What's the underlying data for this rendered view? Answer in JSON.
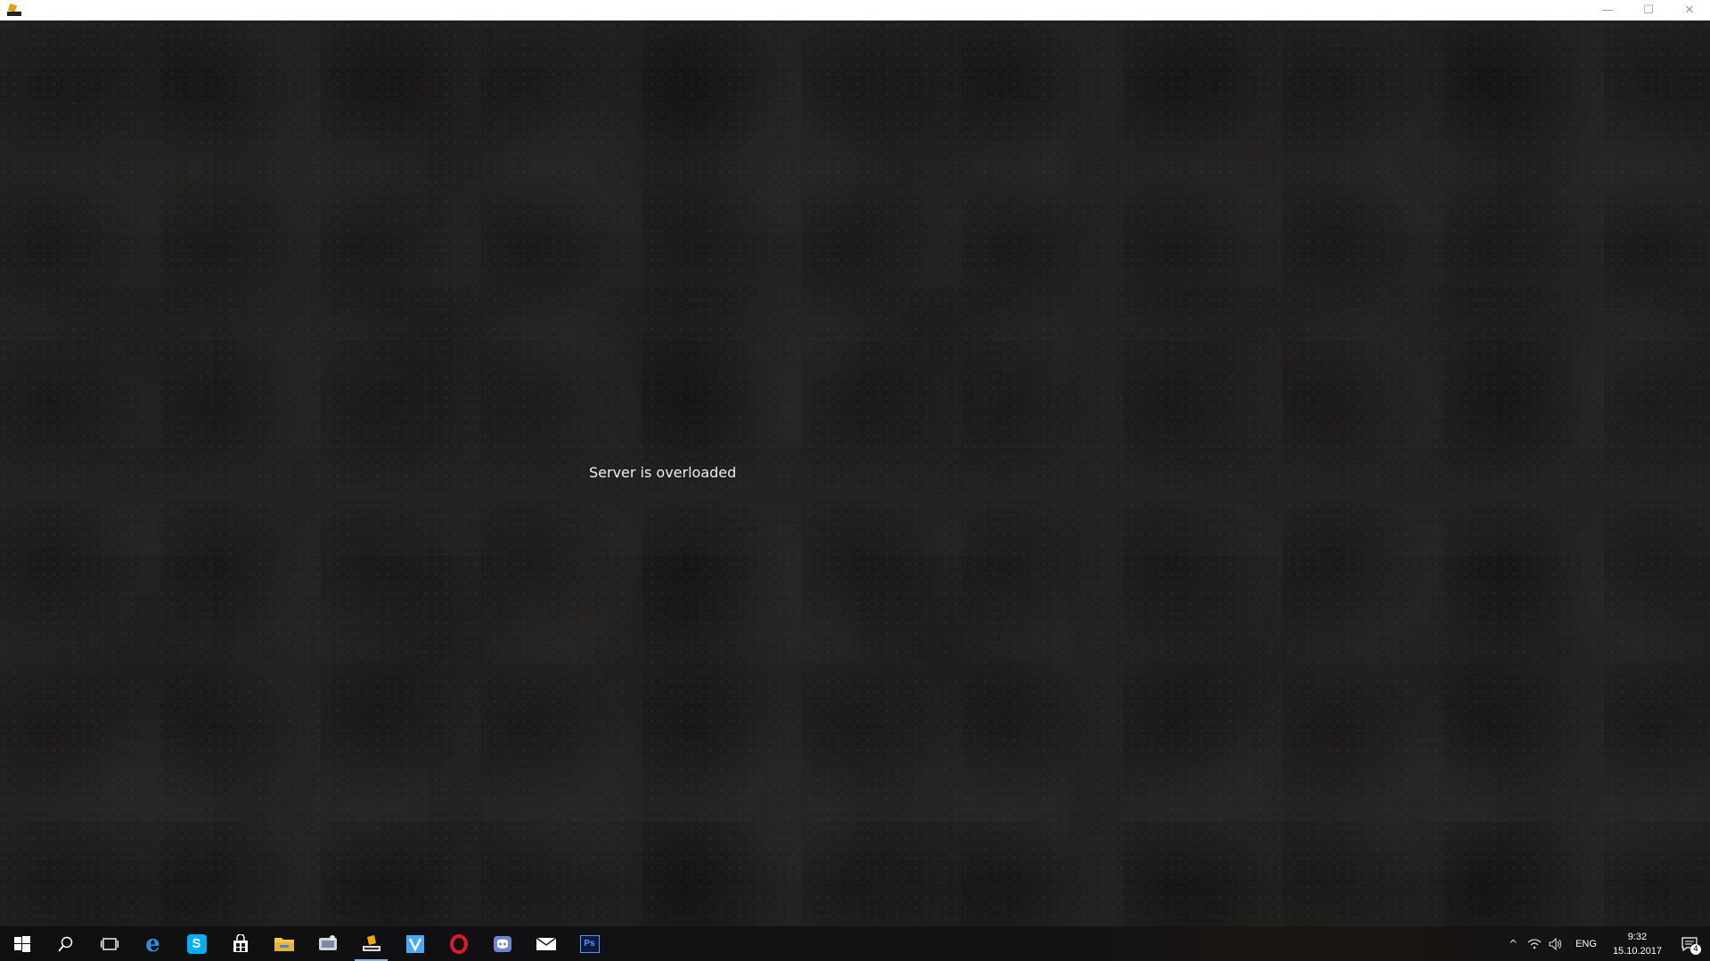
{
  "titlebar": {
    "minimize_glyph": "—",
    "maximize_glyph": "☐",
    "close_glyph": "✕"
  },
  "main": {
    "message": "Server is overloaded"
  },
  "taskbar": {
    "items": [
      {
        "icon": "windows-start-icon"
      },
      {
        "icon": "search-icon"
      },
      {
        "icon": "task-view-icon"
      },
      {
        "icon": "edge-browser-icon"
      },
      {
        "icon": "skype-icon"
      },
      {
        "icon": "store-icon"
      },
      {
        "icon": "file-explorer-icon"
      },
      {
        "icon": "app-icon"
      },
      {
        "icon": "game-client-icon",
        "active": true
      },
      {
        "icon": "visual-studio-icon"
      },
      {
        "icon": "opera-icon"
      },
      {
        "icon": "discord-icon"
      },
      {
        "icon": "mail-icon"
      },
      {
        "icon": "photoshop-icon"
      }
    ],
    "photoshop_label": "Ps",
    "skype_label": "S",
    "edge_label": "e",
    "tray": {
      "chevron": "^",
      "language": "ENG",
      "time": "9:32",
      "date": "15.10.2017",
      "notification_count": "4"
    }
  }
}
